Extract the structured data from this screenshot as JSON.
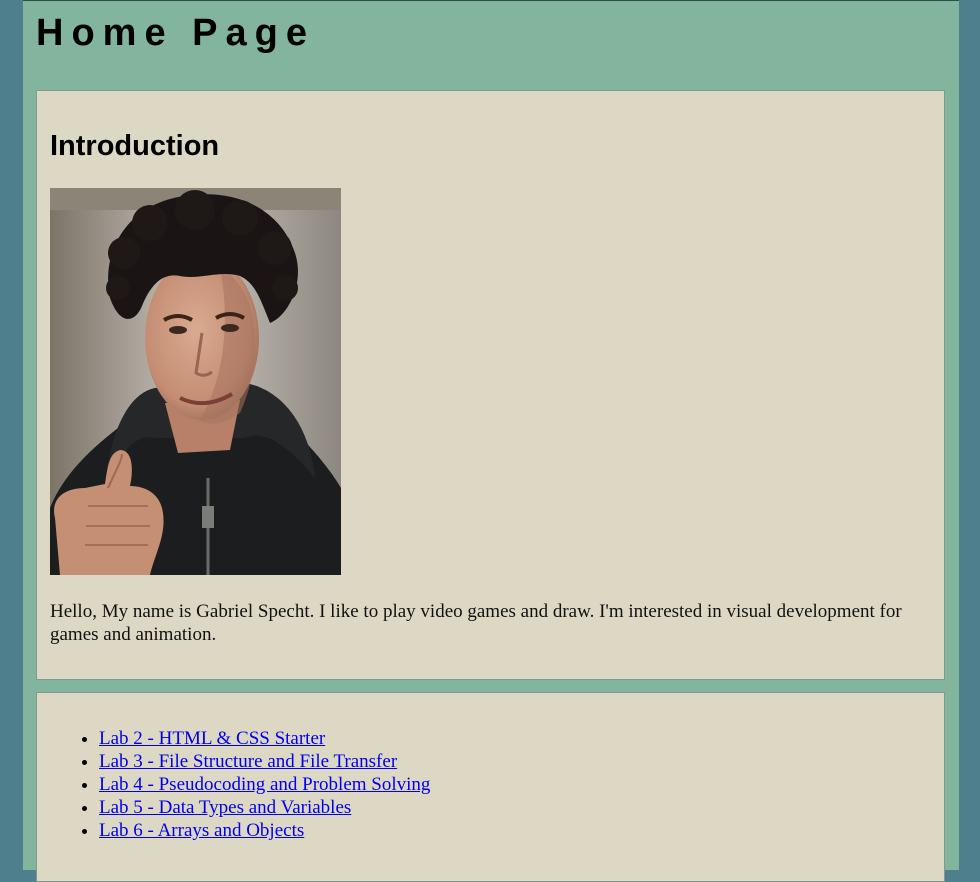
{
  "header": {
    "title": "Home Page"
  },
  "intro": {
    "heading": "Introduction",
    "photo_alt": "Portrait photo of Gabriel Specht giving a thumbs up",
    "text": "Hello, My name is Gabriel Specht. I like to play video games and draw. I'm interested in visual development for games and animation."
  },
  "labs": {
    "items": [
      {
        "label": "Lab 2 - HTML & CSS Starter"
      },
      {
        "label": "Lab 3 - File Structure and File Transfer"
      },
      {
        "label": "Lab 4 - Pseudocoding and Problem Solving"
      },
      {
        "label": "Lab 5 - Data Types and Variables"
      },
      {
        "label": "Lab 6 - Arrays and Objects"
      }
    ]
  },
  "colors": {
    "outer_background": "#4d7f8d",
    "page_background": "#83b59e",
    "card_background": "#ddd8c4",
    "link": "#0000ee"
  }
}
